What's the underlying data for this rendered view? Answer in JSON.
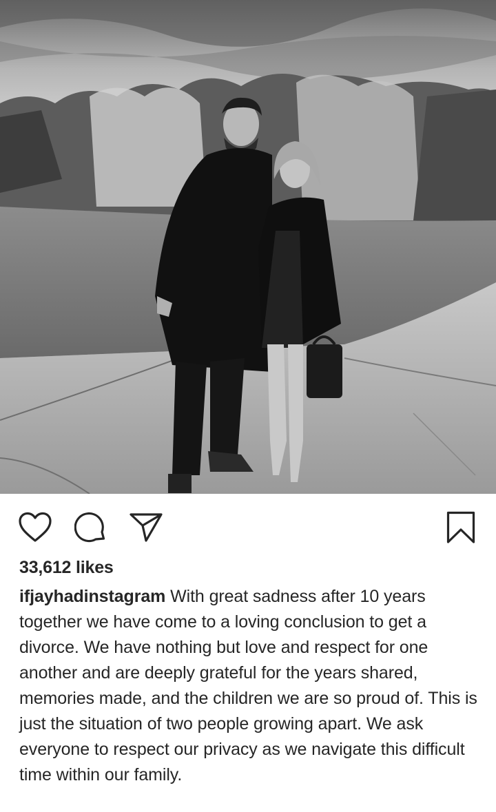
{
  "post": {
    "image_description_icon": "post-photo",
    "likes_text": "33,612 likes",
    "username": "ifjayhadinstagram",
    "caption": "With great sadness after 10 years together we have come to a loving conclusion to get a divorce. We have nothing but love and respect for one another and are deeply grateful for the years shared, memories made, and the children we are so proud of. This is just the situation of two people growing apart. We ask everyone to respect our privacy as we navigate this difficult time within our family."
  },
  "actions": {
    "like_icon": "heart-icon",
    "comment_icon": "comment-bubble-icon",
    "share_icon": "paper-plane-icon",
    "save_icon": "bookmark-icon"
  },
  "colors": {
    "text": "#262626",
    "background": "#ffffff",
    "icon": "#262626"
  }
}
